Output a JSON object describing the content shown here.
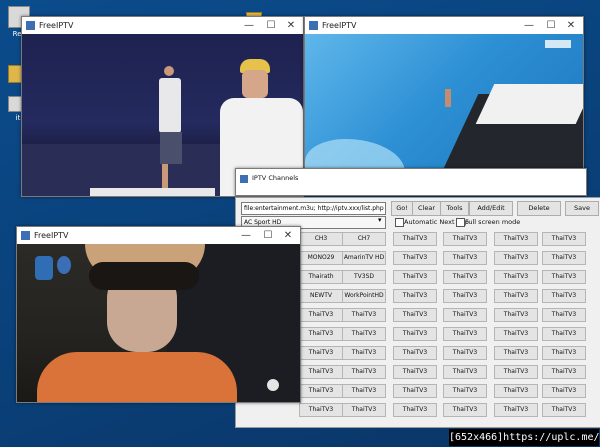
{
  "desktop": {
    "icons": [
      {
        "label": "Rec"
      },
      {
        "label": ""
      },
      {
        "label": "iti"
      }
    ]
  },
  "windows": {
    "tennis": {
      "title": "FreeIPTV",
      "ctl_min": "—",
      "ctl_max": "☐",
      "ctl_close": "✕"
    },
    "pool": {
      "title": "FreeIPTV",
      "ctl_min": "—",
      "ctl_max": "☐",
      "ctl_close": "✕"
    },
    "drama": {
      "title": "FreeIPTV",
      "ctl_min": "—",
      "ctl_max": "☐",
      "ctl_close": "✕"
    },
    "iptv_channels": {
      "title": "IPTV Channels"
    }
  },
  "panel": {
    "url": "file:entertainment.m3u; http://iptv.xxx/list.php",
    "go_label": "Go!",
    "clear_label": "Clear",
    "tools_label": "Tools",
    "addedit_label": "Add/Edit",
    "delete_label": "Delete",
    "save_label": "Save",
    "group": "AC Sport HD",
    "auto_next": "Automatic Next Clip",
    "full_screen": "Full screen mode",
    "channels": [
      [
        "CH3",
        "CH7",
        "ThaiTV3",
        "ThaiTV3",
        "ThaiTV3",
        "ThaiTV3"
      ],
      [
        "MONO29",
        "AmarinTV HD",
        "ThaiTV3",
        "ThaiTV3",
        "ThaiTV3",
        "ThaiTV3"
      ],
      [
        "Thairath",
        "TV3SD",
        "ThaiTV3",
        "ThaiTV3",
        "ThaiTV3",
        "ThaiTV3"
      ],
      [
        "NEWTV",
        "WorkPointHD",
        "ThaiTV3",
        "ThaiTV3",
        "ThaiTV3",
        "ThaiTV3"
      ],
      [
        "ThaiTV3",
        "ThaiTV3",
        "ThaiTV3",
        "ThaiTV3",
        "ThaiTV3",
        "ThaiTV3"
      ],
      [
        "ThaiTV3",
        "ThaiTV3",
        "ThaiTV3",
        "ThaiTV3",
        "ThaiTV3",
        "ThaiTV3"
      ],
      [
        "ThaiTV3",
        "ThaiTV3",
        "ThaiTV3",
        "ThaiTV3",
        "ThaiTV3",
        "ThaiTV3"
      ],
      [
        "ThaiTV3",
        "ThaiTV3",
        "ThaiTV3",
        "ThaiTV3",
        "ThaiTV3",
        "ThaiTV3"
      ],
      [
        "ThaiTV3",
        "ThaiTV3",
        "ThaiTV3",
        "ThaiTV3",
        "ThaiTV3",
        "ThaiTV3"
      ],
      [
        "ThaiTV3",
        "ThaiTV3",
        "ThaiTV3",
        "ThaiTV3",
        "ThaiTV3",
        "ThaiTV3"
      ]
    ]
  },
  "watermark": "[652x466]https://uplc.me/"
}
